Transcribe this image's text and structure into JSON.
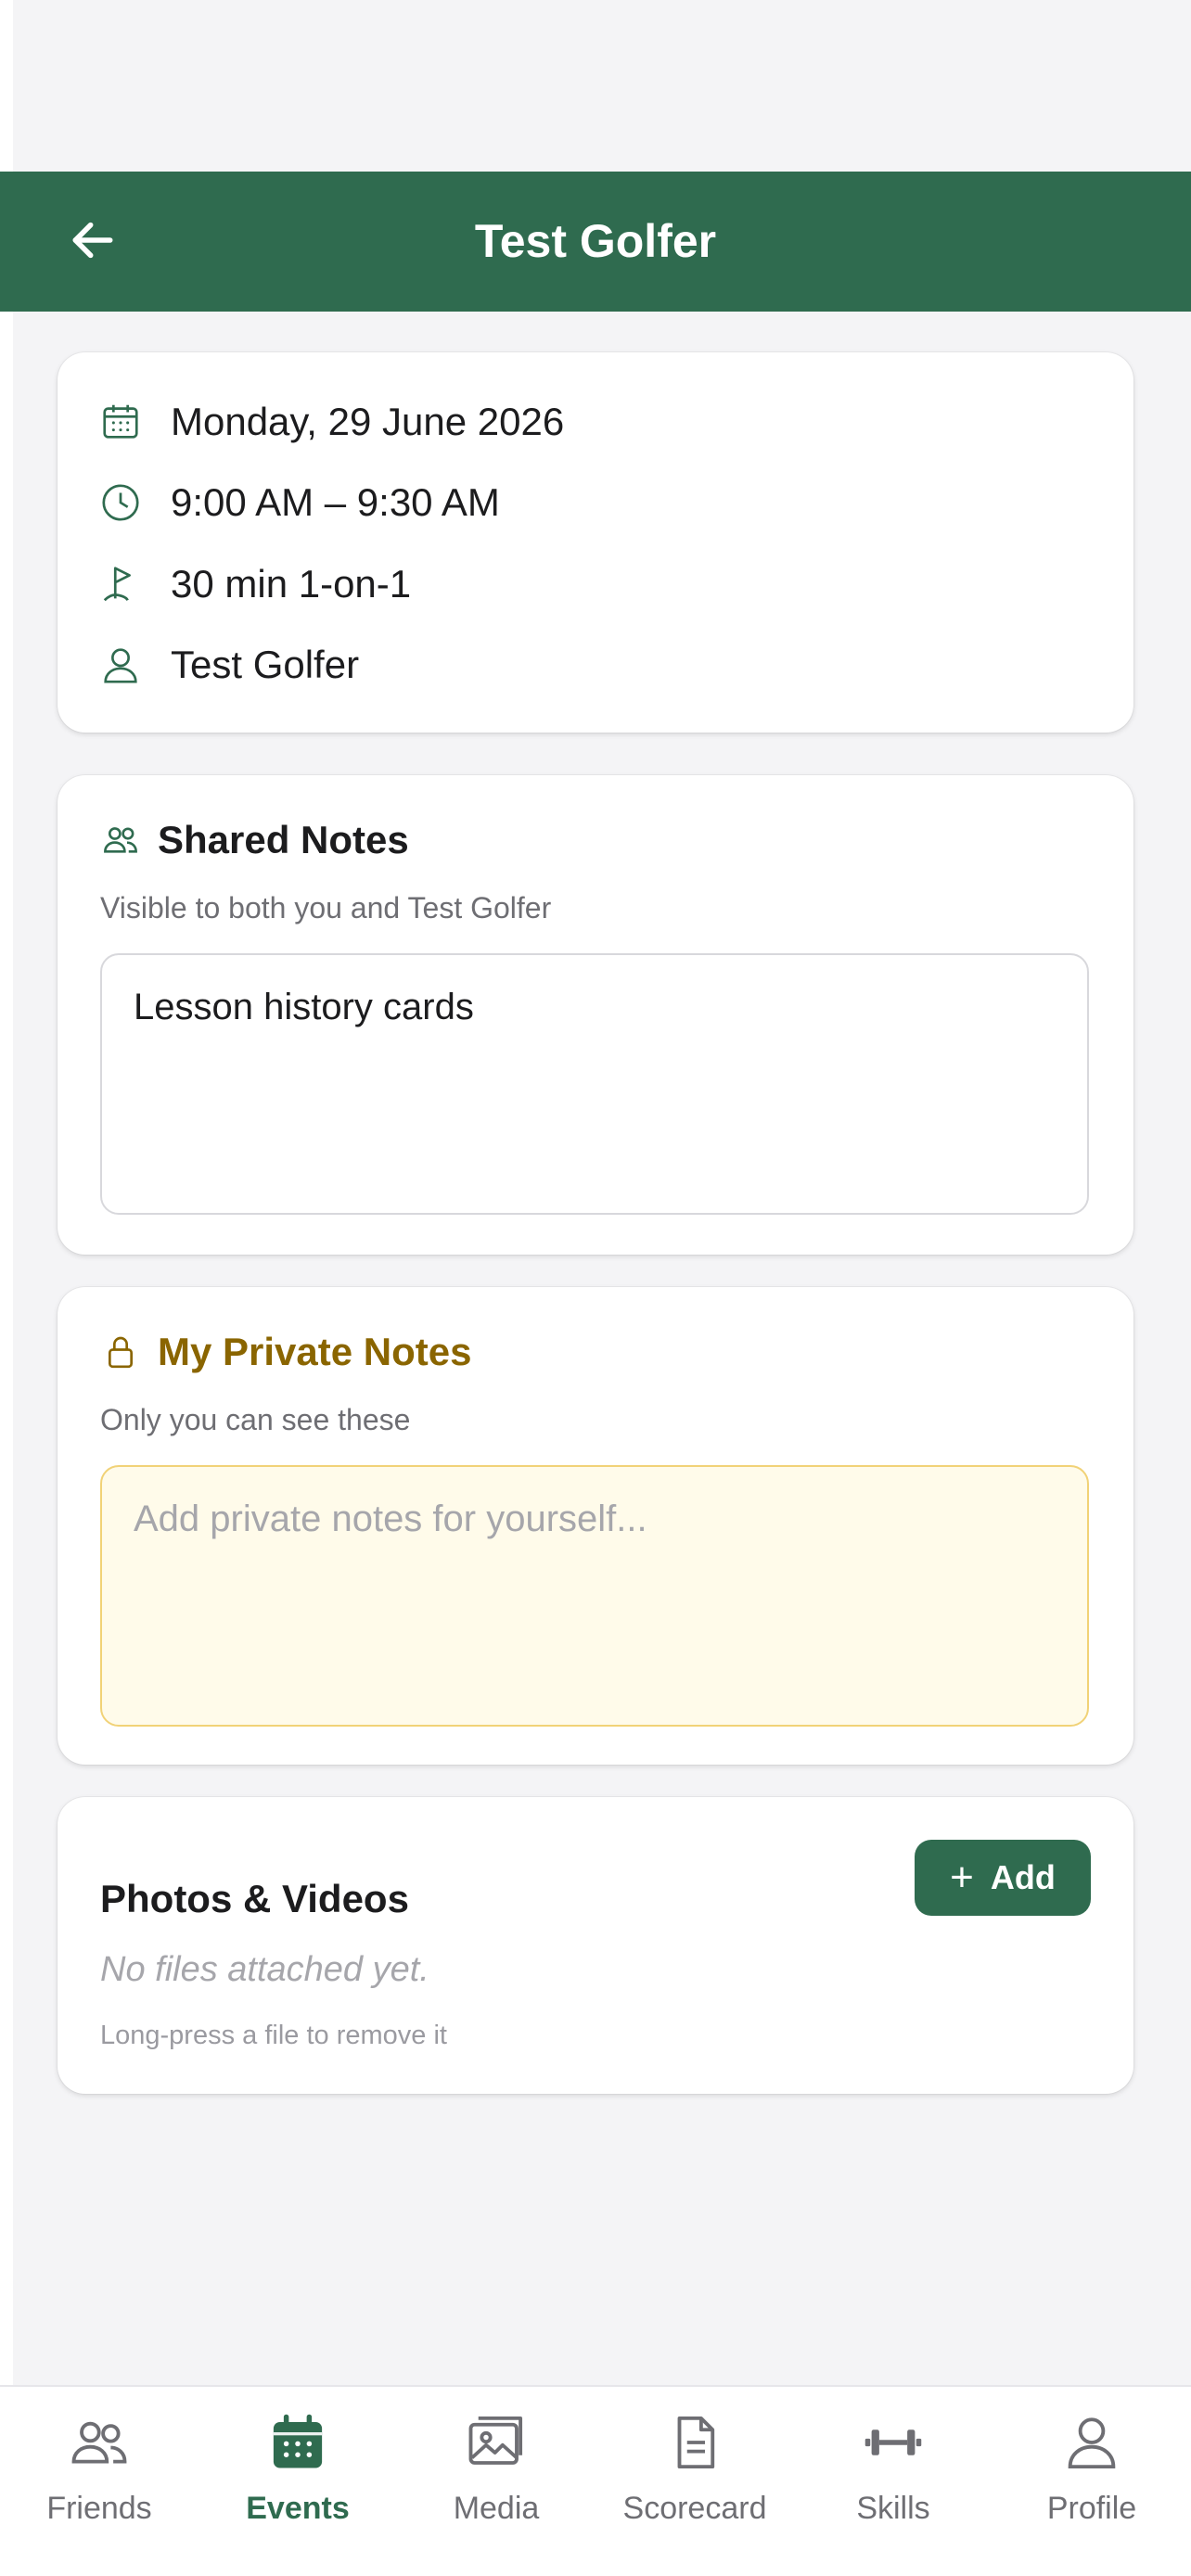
{
  "colors": {
    "brand": "#2f6b4f",
    "private_accent": "#8a6500",
    "private_bg": "#fffbea"
  },
  "header": {
    "title": "Test Golfer",
    "back_icon": "arrow-left-icon"
  },
  "details": {
    "date": "Monday, 29 June 2026",
    "time": "9:00 AM – 9:30 AM",
    "lesson_type": "30 min 1-on-1",
    "student": "Test Golfer"
  },
  "shared_notes": {
    "title": "Shared Notes",
    "subtitle": "Visible to both you and Test Golfer",
    "value": "Lesson history cards"
  },
  "private_notes": {
    "title": "My Private Notes",
    "subtitle": "Only you can see these",
    "placeholder": "Add private notes for yourself..."
  },
  "media": {
    "title": "Photos & Videos",
    "add_label": "Add",
    "empty_text": "No files attached yet.",
    "hint": "Long-press a file to remove it"
  },
  "tabbar": {
    "active": "Events",
    "items": [
      {
        "label": "Friends",
        "icon": "users-icon"
      },
      {
        "label": "Events",
        "icon": "calendar-icon"
      },
      {
        "label": "Media",
        "icon": "images-icon"
      },
      {
        "label": "Scorecard",
        "icon": "document-icon"
      },
      {
        "label": "Skills",
        "icon": "dumbbell-icon"
      },
      {
        "label": "Profile",
        "icon": "person-icon"
      }
    ]
  }
}
